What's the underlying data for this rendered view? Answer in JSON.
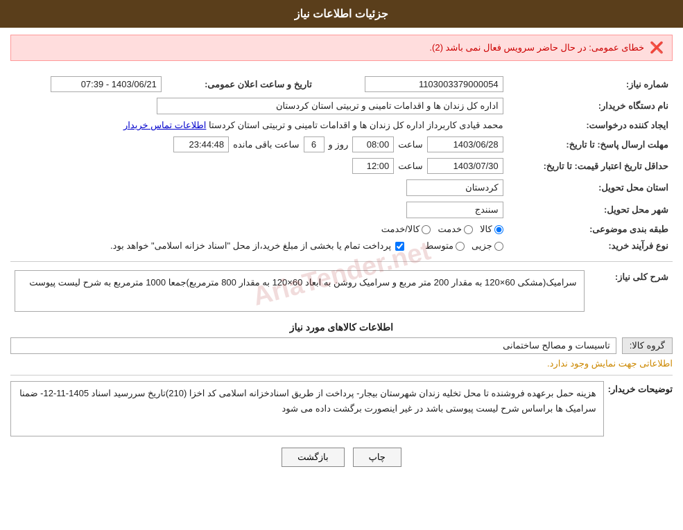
{
  "header": {
    "title": "جزئیات اطلاعات نیاز"
  },
  "error": {
    "message": "خطای عمومی: در حال حاضر سرویس فعال نمی باشد (2)."
  },
  "fields": {
    "need_number_label": "شماره نیاز:",
    "need_number_value": "1103003379000054",
    "date_label": "تاریخ و ساعت اعلان عمومی:",
    "date_value": "1403/06/21 - 07:39",
    "buyer_name_label": "نام دستگاه خریدار:",
    "buyer_name_value": "اداره کل زندان ها و اقدامات تامینی و تربیتی استان کردستان",
    "creator_label": "ایجاد کننده درخواست:",
    "creator_value": "محمد  قیادی کاربرداز اداره کل زندان ها و اقدامات تامینی و تربیتی استان کردستا",
    "creator_link": "اطلاعات تماس خریدار",
    "deadline_label": "مهلت ارسال پاسخ: تا تاریخ:",
    "deadline_date": "1403/06/28",
    "deadline_time_label": "ساعت",
    "deadline_time": "08:00",
    "deadline_day_label": "روز و",
    "deadline_days": "6",
    "deadline_remaining_label": "ساعت باقی مانده",
    "deadline_remaining": "23:44:48",
    "price_deadline_label": "حداقل تاریخ اعتبار قیمت: تا تاریخ:",
    "price_deadline_date": "1403/07/30",
    "price_deadline_time_label": "ساعت",
    "price_deadline_time": "12:00",
    "province_label": "استان محل تحویل:",
    "province_value": "کردستان",
    "city_label": "شهر محل تحویل:",
    "city_value": "سنندج",
    "category_label": "طبقه بندی موضوعی:",
    "category_options": [
      "کالا",
      "خدمت",
      "کالا/خدمت"
    ],
    "category_selected": "کالا",
    "process_label": "نوع فرآیند خرید:",
    "process_options": [
      "جزیی",
      "متوسط"
    ],
    "process_selected": "",
    "checkbox_label": "پرداخت تمام یا بخشی از مبلغ خرید،از محل \"اسناد خزانه اسلامی\" خواهد بود.",
    "checkbox_checked": true,
    "need_desc_label": "شرح کلی نیاز:",
    "need_desc_value": "سرامیک(مشکی  60×120  به مقدار 200 متر مربع  و  سرامیک روشن به ابعاد 60×120 به مقدار 800 مترمربع)جمعا 1000 مترمربع به شرح لیست پیوست",
    "goods_section_label": "اطلاعات کالاهای مورد نیاز",
    "goods_group_label": "گروه کالا:",
    "goods_group_value": "تاسیسات و مصالح ساختمانی",
    "no_info_label": "اطلاعاتی جهت نمایش وجود ندارد.",
    "buyer_desc_label": "توضیحات خریدار:",
    "buyer_desc_value": "هزینه حمل برعهده فروشنده  تا محل  تخلیه  زندان  شهرستان بیجار- پرداخت از طریق اسنادخزانه اسلامی کد اخزا (210)تاریخ سررسید اسناد 1405-11-12- ضمنا سرامیک ها براساس شرح لیست پیوستی باشد در غیر اینصورت برگشت داده می شود"
  },
  "buttons": {
    "print_label": "چاپ",
    "back_label": "بازگشت"
  },
  "watermark": "AriaTender.net"
}
